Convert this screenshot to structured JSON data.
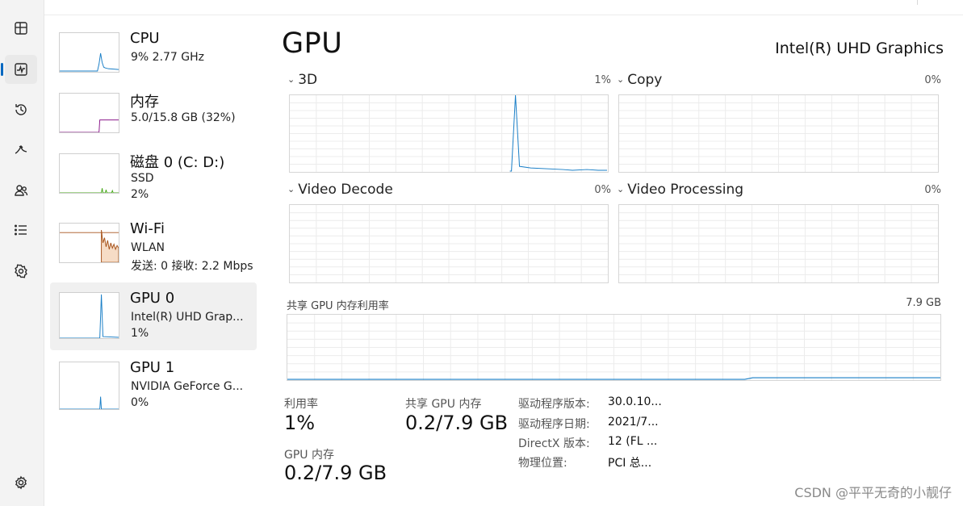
{
  "rail": {
    "icons": [
      "processes-icon",
      "performance-icon",
      "app-history-icon",
      "startup-apps-icon",
      "users-icon",
      "details-icon",
      "services-icon",
      "settings-icon"
    ],
    "active": "performance-icon"
  },
  "devices": [
    {
      "name": "CPU",
      "line1": "9% 2.77 GHz",
      "line2": ""
    },
    {
      "name": "内存",
      "line1": "5.0/15.8 GB (32%)",
      "line2": ""
    },
    {
      "name": "磁盘 0 (C: D:)",
      "line1": "SSD",
      "line2": "2%"
    },
    {
      "name": "Wi-Fi",
      "line1": "WLAN",
      "line2": "发送: 0 接收: 2.2 Mbps"
    },
    {
      "name": "GPU 0",
      "line1": "Intel(R) UHD Grap...",
      "line2": "1%"
    },
    {
      "name": "GPU 1",
      "line1": "NVIDIA GeForce G...",
      "line2": "0%"
    }
  ],
  "colors": {
    "cpu": "#1a7fc7",
    "memory": "#8b1a8b",
    "disk": "#4caa1f",
    "wifi": "#a7541c",
    "gpu": "#1a7fc7",
    "accent": "#0067c0"
  },
  "main": {
    "title": "GPU",
    "adapter": "Intel(R) UHD Graphics",
    "engines": [
      {
        "label": "3D",
        "percent": "1%"
      },
      {
        "label": "Copy",
        "percent": "0%"
      },
      {
        "label": "Video Decode",
        "percent": "0%"
      },
      {
        "label": "Video Processing",
        "percent": "0%"
      }
    ],
    "shared_memory_label": "共享 GPU 内存利用率",
    "shared_memory_max": "7.9 GB"
  },
  "stats": {
    "utilization_label": "利用率",
    "utilization_value": "1%",
    "shared_mem_label": "共享 GPU 内存",
    "shared_mem_value": "0.2/7.9 GB",
    "gpu_mem_label": "GPU 内存",
    "gpu_mem_value": "0.2/7.9 GB"
  },
  "details": [
    {
      "key": "驱动程序版本:",
      "value": "30.0.10..."
    },
    {
      "key": "驱动程序日期:",
      "value": "2021/7..."
    },
    {
      "key": "DirectX 版本:",
      "value": "12 (FL ..."
    },
    {
      "key": "物理位置:",
      "value": "PCI 总..."
    }
  ],
  "watermark": "CSDN @平平无奇的小靓仔"
}
